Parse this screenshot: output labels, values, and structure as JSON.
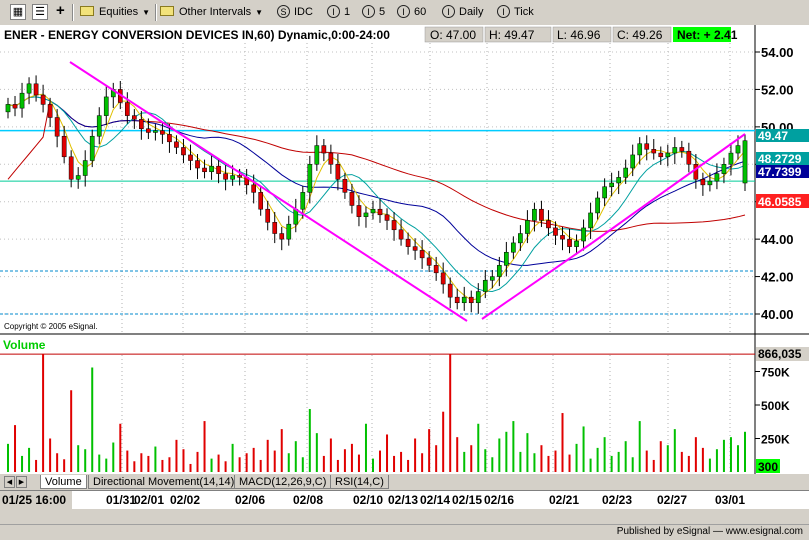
{
  "toolbar": {
    "equities_label": "Equities",
    "intervals_label": "Other Intervals",
    "idc_label": "IDC",
    "int1_label": "1",
    "int5_label": "5",
    "int60_label": "60",
    "daily_label": "Daily",
    "tick_label": "Tick",
    "s_glyph": "S",
    "i_glyph": "I",
    "plus_glyph": "+"
  },
  "header": {
    "title": "ENER - ENERGY CONVERSION DEVICES IN,60) Dynamic,0:00-24:00",
    "open": "O: 47.00",
    "high": "H: 49.47",
    "low": "L: 46.96",
    "close": "C: 49.26",
    "net": "Net: + 2.41"
  },
  "copyright": "Copyright © 2005 eSignal.",
  "volume_title": "Volume",
  "price_labels": {
    "last": "49.47",
    "ma_fast": "48.2729",
    "ma_mid": "47.7399",
    "ma_slow": "46.0585"
  },
  "volume_last": "866,035",
  "volume_last_short": "300",
  "tabs": [
    "Volume",
    "Directional Movement(14,14)",
    "MACD(12,26,9,C)",
    "RSI(14,C)"
  ],
  "time_axis": {
    "cursor_label": "01/25 16:00",
    "labels": [
      "01/31",
      "02/01",
      "02/02",
      "02/06",
      "02/08",
      "02/10",
      "02/13",
      "02/14",
      "02/15",
      "02/16",
      "02/21",
      "02/23",
      "02/27",
      "03/01"
    ]
  },
  "publisher": "Published by eSignal — www.esignal.com",
  "colors": {
    "up_candle": "#00c000",
    "down_candle": "#e00000",
    "trendline": "#ff00ff",
    "resistance_line": "#00ccff",
    "support_line": "#00cc99",
    "ma_slow": "#c00000",
    "ma_mid": "#000099",
    "ma_fast": "#00a0a0",
    "ma_short": "#e0c000",
    "net_bg": "#00ff00",
    "ma_slow_label_bg": "#ff2020"
  },
  "chart_data": [
    {
      "type": "candlestick",
      "symbol": "ENER",
      "interval": "60",
      "ylim": [
        39.5,
        55
      ],
      "yticks": [
        40,
        42,
        44,
        46,
        48,
        50,
        52,
        54
      ],
      "ytick_labels": [
        "40.00",
        "42.00",
        "44.00",
        "46.00",
        "48.00",
        "50.00",
        "52.00",
        "54.00"
      ],
      "close": [
        51.2,
        51.0,
        51.8,
        52.3,
        51.7,
        51.2,
        50.5,
        49.5,
        48.4,
        47.2,
        47.4,
        48.2,
        49.5,
        50.6,
        51.6,
        52.0,
        51.3,
        50.6,
        50.4,
        49.9,
        49.7,
        49.8,
        49.6,
        49.2,
        48.9,
        48.5,
        48.2,
        47.8,
        47.6,
        47.9,
        47.5,
        47.2,
        47.4,
        47.3,
        46.9,
        46.5,
        45.6,
        44.9,
        44.3,
        44.0,
        44.8,
        45.6,
        46.5,
        48.0,
        49.0,
        48.6,
        48.0,
        47.2,
        46.5,
        45.8,
        45.2,
        45.4,
        45.6,
        45.3,
        45.0,
        44.5,
        44.0,
        43.6,
        43.4,
        43.0,
        42.6,
        42.2,
        41.6,
        40.9,
        40.6,
        40.9,
        40.6,
        41.2,
        41.8,
        42.0,
        42.6,
        43.3,
        43.8,
        44.3,
        45.0,
        45.6,
        45.0,
        44.6,
        44.2,
        44.0,
        43.6,
        43.9,
        44.6,
        45.4,
        46.2,
        46.8,
        47.0,
        47.3,
        47.8,
        48.5,
        49.1,
        48.8,
        48.6,
        48.4,
        48.6,
        48.9,
        48.7,
        48.0,
        47.2,
        46.9,
        47.1,
        47.5,
        48.0,
        48.6,
        49.0,
        49.26
      ],
      "high": 49.47,
      "low_point": 40.0,
      "last_open": 47.0,
      "volume_ylim": [
        0,
        1000000
      ],
      "volume_ticks": [
        "250K",
        "500K",
        "750K"
      ],
      "volume_max_label": "866,035",
      "volume_values": [
        210000,
        350000,
        120000,
        180000,
        90000,
        880000,
        250000,
        140000,
        95000,
        610000,
        200000,
        170000,
        780000,
        130000,
        100000,
        220000,
        360000,
        160000,
        80000,
        140000,
        120000,
        190000,
        90000,
        110000,
        240000,
        170000,
        60000,
        150000,
        380000,
        100000,
        130000,
        80000,
        210000,
        110000,
        140000,
        180000,
        90000,
        240000,
        160000,
        320000,
        140000,
        230000,
        110000,
        470000,
        290000,
        120000,
        250000,
        90000,
        170000,
        210000,
        130000,
        360000,
        100000,
        160000,
        280000,
        120000,
        150000,
        90000,
        250000,
        140000,
        320000,
        200000,
        450000,
        880000,
        260000,
        150000,
        200000,
        360000,
        170000,
        110000,
        250000,
        300000,
        380000,
        150000,
        290000,
        140000,
        200000,
        120000,
        160000,
        440000,
        130000,
        210000,
        340000,
        100000,
        180000,
        260000,
        120000,
        150000,
        230000,
        110000,
        380000,
        160000,
        90000,
        230000,
        200000,
        320000,
        150000,
        120000,
        260000,
        180000,
        100000,
        170000,
        240000,
        260000,
        200000,
        300000
      ]
    }
  ]
}
